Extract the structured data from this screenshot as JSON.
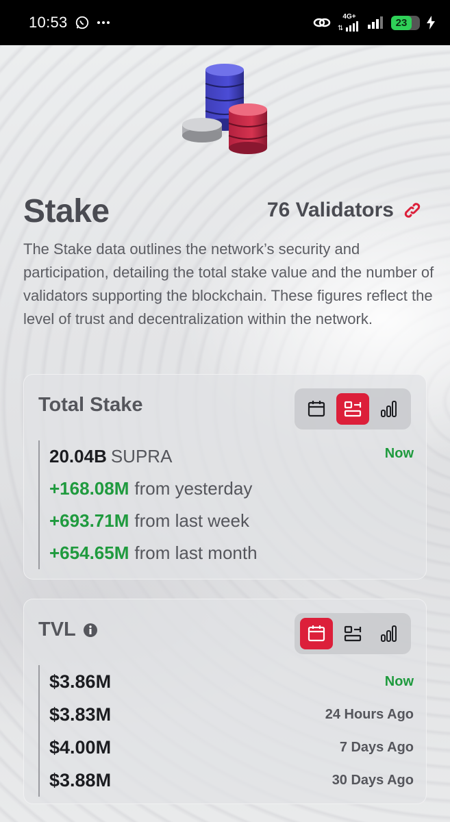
{
  "status_bar": {
    "time": "10:53",
    "network_type": "4G+",
    "battery": "23"
  },
  "header": {
    "title": "Stake",
    "validators_label": "76 Validators",
    "description": "The Stake data outlines the network’s security and participation, detailing the total stake value and the number of validators supporting the blockchain. These figures reflect the level of trust and decentralization within the network."
  },
  "total_stake": {
    "title": "Total Stake",
    "active_view": "list",
    "amount": "20.04B",
    "unit": "SUPRA",
    "now_label": "Now",
    "changes": [
      {
        "delta": "+168.08M",
        "label": "from yesterday"
      },
      {
        "delta": "+693.71M",
        "label": "from last week"
      },
      {
        "delta": "+654.65M",
        "label": "from last month"
      }
    ]
  },
  "tvl": {
    "title": "TVL",
    "active_view": "calendar",
    "rows": [
      {
        "value": "$3.86M",
        "time": "Now"
      },
      {
        "value": "$3.83M",
        "time": "24 Hours Ago"
      },
      {
        "value": "$4.00M",
        "time": "7 Days Ago"
      },
      {
        "value": "$3.88M",
        "time": "30 Days Ago"
      }
    ]
  },
  "colors": {
    "accent": "#dc1f3a",
    "positive": "#1f9a3e",
    "heading": "#4a4b52"
  },
  "icons": {
    "hero": "coin-stacks-icon",
    "validators_link": "link-icon",
    "tvl_info": "info-icon",
    "toggle": [
      "calendar-icon",
      "list-icon",
      "bar-chart-icon"
    ]
  }
}
